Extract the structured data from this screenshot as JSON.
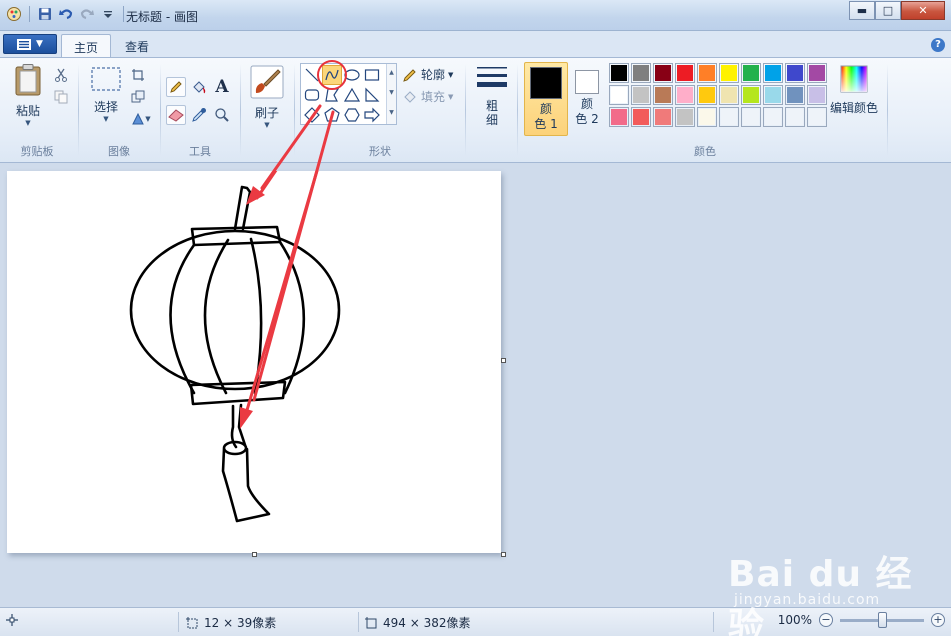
{
  "window": {
    "title": "无标题 - 画图",
    "controls": {
      "minimize": "▬",
      "maximize": "□",
      "close": "✕"
    }
  },
  "tabs": [
    {
      "label": "主页",
      "active": true
    },
    {
      "label": "查看",
      "active": false
    }
  ],
  "ribbon": {
    "clipboard": {
      "paste_label": "粘贴",
      "group_label": "剪贴板"
    },
    "image": {
      "select_label": "选择",
      "group_label": "图像"
    },
    "tools": {
      "group_label": "工具"
    },
    "brushes": {
      "label": "刷子"
    },
    "shapes": {
      "group_label": "形状",
      "outline_label": "轮廓",
      "fill_label": "填充",
      "selected_shape": "curve"
    },
    "size": {
      "label": "粗\n细"
    },
    "colors": {
      "group_label": "颜色",
      "color1_label": "颜\n色 1",
      "color2_label": "颜\n色 2",
      "edit_colors_label": "编辑颜色",
      "color1": "#000000",
      "color2": "#ffffff",
      "row1": [
        "#000000",
        "#7f7f7f",
        "#880015",
        "#ed1c24",
        "#ff7f27",
        "#fff200",
        "#22b14c",
        "#00a2e8",
        "#3f48cc",
        "#a349a4"
      ],
      "row2": [
        "#ffffff",
        "#c3c3c3",
        "#b97a57",
        "#ffaec9",
        "#ffc90e",
        "#efe4b0",
        "#b5e61d",
        "#99d9ea",
        "#7092be",
        "#c8bfe7"
      ],
      "row3": [
        "#f26b8a",
        "#f25b5b",
        "#f07a7a",
        "#c3c3c3",
        "#fbf8ea",
        "#eef3f9",
        "#eef3f9",
        "#eef3f9",
        "#eef3f9",
        "#eef3f9"
      ]
    }
  },
  "statusbar": {
    "selection_size": "12 × 39像素",
    "canvas_size": "494 × 382像素",
    "zoom": "100%",
    "zoom_level": 1.0
  },
  "watermark": {
    "main": "Bai du 经验",
    "sub": "jingyan.baidu.com"
  }
}
